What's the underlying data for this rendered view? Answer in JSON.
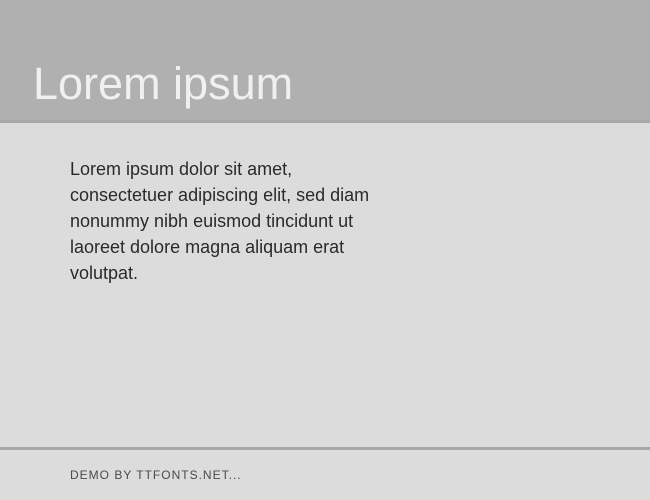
{
  "header": {
    "title": "Lorem ipsum"
  },
  "content": {
    "body_text": "Lorem ipsum dolor sit amet, consectetuer adipiscing elit, sed diam nonummy nibh euismod tincidunt ut laoreet dolore magna aliquam erat volutpat."
  },
  "footer": {
    "text": "DEMO BY TTFONTS.NET..."
  }
}
